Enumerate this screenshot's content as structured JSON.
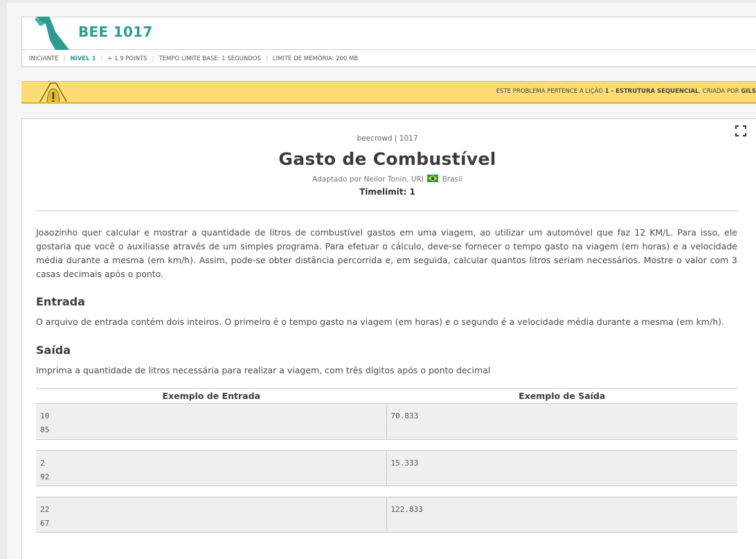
{
  "header": {
    "problem_code": "BEE 1017",
    "category": "INICIANTE",
    "level": "NÍVEL 1",
    "points": "+ 1.9 POINTS",
    "time_limit": "TEMPO LIMITE BASE: 1 SEGUNDOS",
    "memory_limit": "LIMITE DE MEMÓRIA: 200 MB"
  },
  "alert": {
    "prefix": "ESTE PROBLEMA PERTENCE A LIÇÃO ",
    "lesson": "1 - ESTRUTURA SEQUENCIAL",
    "suffix": ", CRIADA POR ",
    "author": "GILS"
  },
  "problem": {
    "source": "beecrowd | 1017",
    "title": "Gasto de Combustível",
    "adapted_by": "Adaptado por Neilor Tonin, URI",
    "country": "Brasil",
    "timelimit": "Timelimit: 1",
    "description": "Joaozinho quer calcular e mostrar a quantidade de litros de combustível gastos em uma viagem, ao utilizar um automóvel que faz 12 KM/L. Para isso, ele gostaria que você o auxiliasse através de um simples programa. Para efetuar o cálculo, deve-se fornecer o tempo gasto na viagem (em horas) e a velocidade média durante a mesma (em km/h). Assim, pode-se obter distância percorrida e, em seguida, calcular quantos litros seriam necessários. Mostre o valor com 3 casas decimais após o ponto.",
    "input_heading": "Entrada",
    "input_text": "O arquivo de entrada contém dois inteiros. O primeiro é o tempo gasto na viagem (em horas) e o segundo é a velocidade média durante a mesma (em km/h).",
    "output_heading": "Saída",
    "output_text": "Imprima a quantidade de litros necessária para realizar a viagem, com três dígitos após o ponto decimal"
  },
  "samples": {
    "input_header": "Exemplo de Entrada",
    "output_header": "Exemplo de Saída",
    "rows": [
      {
        "input": "10\n85",
        "output": "70.833"
      },
      {
        "input": "2\n92",
        "output": "15.333"
      },
      {
        "input": "22\n67",
        "output": "122.833"
      }
    ]
  },
  "colors": {
    "accent": "#2c9c93",
    "alert_bg": "#fddd73"
  },
  "icons": {
    "level": "level-1-logo-icon",
    "alert": "warning-bell-icon",
    "expand": "fullscreen-expand-icon",
    "flag": "brazil-flag-icon"
  }
}
